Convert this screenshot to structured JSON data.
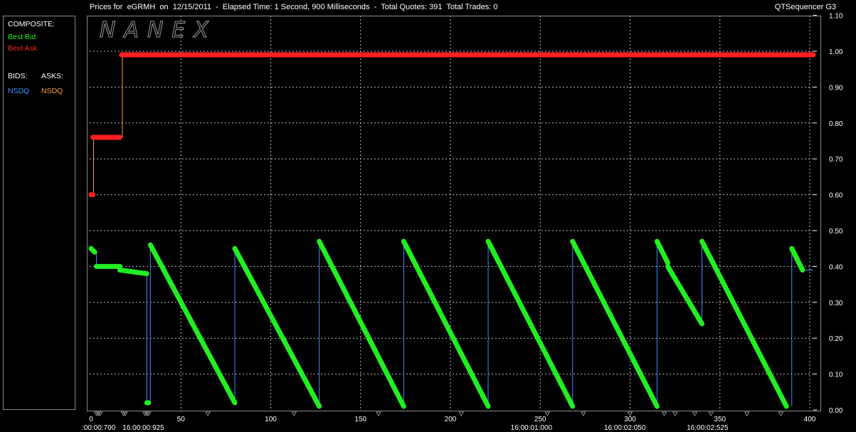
{
  "header": {
    "title": "Prices for  eGRMH  on  12/15/2011  -  Elapsed Time: 1 Second, 900 Milliseconds  -  Total Quotes: 391  Total Trades: 0",
    "app_name": "QTSequencer G3"
  },
  "legend": {
    "composite_label": "COMPOSITE:",
    "best_bid": "Best Bid",
    "best_ask": "Best Ask",
    "bids_label": "BIDS:",
    "asks_label": "ASKS:",
    "bid_exchange": "NSDQ",
    "ask_exchange": "NSDQ"
  },
  "colors": {
    "best_bid": "#22ee22",
    "best_ask": "#ff2020",
    "bid_exchange": "#3a8fff",
    "ask_exchange": "#ff9a40",
    "grid": "#bbbbbb"
  },
  "watermark": "NANEX",
  "chart_data": {
    "type": "line",
    "title": "Prices for  eGRMH  on  12/15/2011  -  Elapsed Time: 1 Second, 900 Milliseconds  -  Total Quotes: 391  Total Trades: 0",
    "xlim": [
      0,
      402
    ],
    "ylim": [
      0.0,
      1.1
    ],
    "x_ticks": [
      0,
      50,
      100,
      150,
      200,
      250,
      300,
      350,
      400
    ],
    "y_ticks": [
      "0.00",
      "0.10",
      "0.20",
      "0.30",
      "0.40",
      "0.50",
      "0.60",
      "0.70",
      "0.80",
      "0.90",
      "1.00",
      "1.10"
    ],
    "time_labels": [
      {
        "x": 0,
        "label": ":00:00:700"
      },
      {
        "x": 31,
        "label": "16:00:00:925"
      },
      {
        "x": 247,
        "label": "16:00:01:000"
      },
      {
        "x": 299,
        "label": "16:00:02:050"
      },
      {
        "x": 345,
        "label": "16:00:02:525"
      }
    ],
    "grid": true,
    "legend_position": "left",
    "series": [
      {
        "name": "Best Ask",
        "segments": [
          {
            "x0": 0,
            "x1": 1,
            "y0": 0.6,
            "y1": 0.6
          },
          {
            "x0": 1,
            "x1": 16,
            "y0": 0.76,
            "y1": 0.76
          },
          {
            "x0": 17,
            "x1": 402,
            "y0": 0.99,
            "y1": 0.99
          }
        ]
      },
      {
        "name": "Best Bid",
        "segments": [
          {
            "x0": 0,
            "x1": 2,
            "y0": 0.45,
            "y1": 0.44
          },
          {
            "x0": 3,
            "x1": 16,
            "y0": 0.4,
            "y1": 0.4
          },
          {
            "x0": 16,
            "x1": 31,
            "y0": 0.39,
            "y1": 0.38
          },
          {
            "x0": 31,
            "x1": 32,
            "y0": 0.02,
            "y1": 0.02
          },
          {
            "x0": 33,
            "x1": 80,
            "y0": 0.46,
            "y1": 0.02
          },
          {
            "x0": 80,
            "x1": 127,
            "y0": 0.45,
            "y1": 0.01
          },
          {
            "x0": 127,
            "x1": 174,
            "y0": 0.47,
            "y1": 0.01
          },
          {
            "x0": 174,
            "x1": 221,
            "y0": 0.47,
            "y1": 0.01
          },
          {
            "x0": 221,
            "x1": 268,
            "y0": 0.47,
            "y1": 0.01
          },
          {
            "x0": 268,
            "x1": 315,
            "y0": 0.47,
            "y1": 0.01
          },
          {
            "x0": 315,
            "x1": 321,
            "y0": 0.47,
            "y1": 0.41
          },
          {
            "x0": 321,
            "x1": 340,
            "y0": 0.4,
            "y1": 0.24
          },
          {
            "x0": 340,
            "x1": 387,
            "y0": 0.47,
            "y1": 0.01
          },
          {
            "x0": 390,
            "x1": 396,
            "y0": 0.45,
            "y1": 0.39
          }
        ]
      }
    ]
  }
}
